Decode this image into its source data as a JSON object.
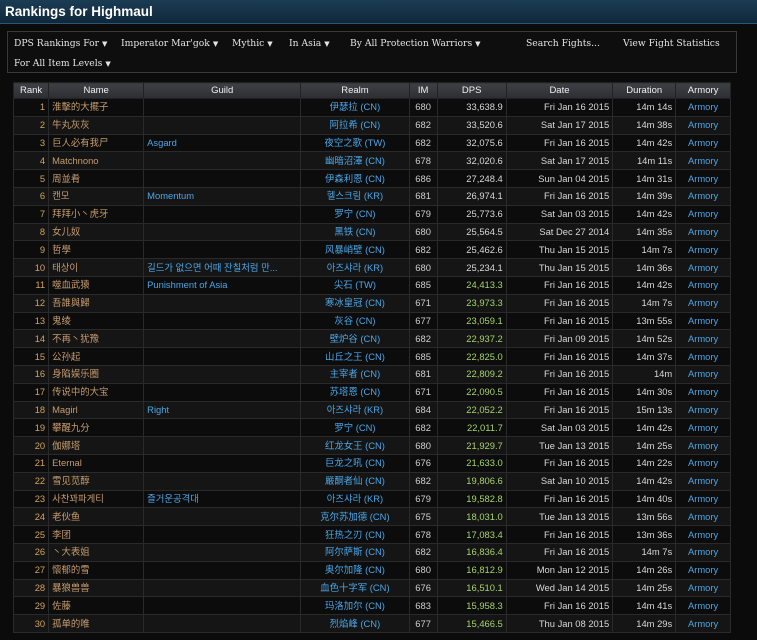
{
  "page": {
    "title": "Rankings for Highmaul"
  },
  "filters": {
    "row1": [
      {
        "label": "DPS Rankings For",
        "dropdown": true
      },
      {
        "label": "Imperator Mar'gok",
        "dropdown": true
      },
      {
        "label": "Mythic",
        "dropdown": true
      },
      {
        "label": "In Asia",
        "dropdown": true
      },
      {
        "label": "By All Protection Warriors",
        "dropdown": true
      },
      {
        "label": "Search Fights...",
        "dropdown": false
      },
      {
        "label": "View Fight Statistics",
        "dropdown": false
      }
    ],
    "row2": [
      {
        "label": "For All Item Levels",
        "dropdown": true
      }
    ]
  },
  "table": {
    "headers": [
      "Rank",
      "Name",
      "Guild",
      "Realm",
      "IM",
      "DPS",
      "Date",
      "Duration",
      "Armory"
    ],
    "rows": [
      [
        "1",
        "淮擊的大擺子",
        "",
        "伊瑟拉 (CN)",
        "680",
        "33,638.9",
        "Fri Jan 16 2015",
        "14m 14s",
        "Armory"
      ],
      [
        "2",
        "牛丸灰灰",
        "",
        "阿拉希 (CN)",
        "682",
        "33,520.6",
        "Sat Jan 17 2015",
        "14m 38s",
        "Armory"
      ],
      [
        "3",
        "巨人必有我尸",
        "Asgard",
        "夜空之歌 (TW)",
        "682",
        "32,075.6",
        "Fri Jan 16 2015",
        "14m 42s",
        "Armory"
      ],
      [
        "4",
        "Matchnono",
        "",
        "幽暗沼澤 (CN)",
        "678",
        "32,020.6",
        "Sat Jan 17 2015",
        "14m 11s",
        "Armory"
      ],
      [
        "5",
        "周並肴",
        "",
        "伊森利恩 (CN)",
        "686",
        "27,248.4",
        "Sun Jan 04 2015",
        "14m 31s",
        "Armory"
      ],
      [
        "6",
        "캔모",
        "Momentum",
        "헬스크림 (KR)",
        "681",
        "26,974.1",
        "Fri Jan 16 2015",
        "14m 39s",
        "Armory"
      ],
      [
        "7",
        "拜拜小丶虎牙",
        "",
        "罗宁 (CN)",
        "679",
        "25,773.6",
        "Sat Jan 03 2015",
        "14m 42s",
        "Armory"
      ],
      [
        "8",
        "女儿奴",
        "",
        "黑铁 (CN)",
        "680",
        "25,564.5",
        "Sat Dec 27 2014",
        "14m 35s",
        "Armory"
      ],
      [
        "9",
        "哲學",
        "",
        "风暴峭壁 (CN)",
        "682",
        "25,462.6",
        "Thu Jan 15 2015",
        "14m 7s",
        "Armory"
      ],
      [
        "10",
        "태상이",
        "길드가 없으면 어때 잔칠처럼 만...",
        "아즈샤라 (KR)",
        "680",
        "25,234.1",
        "Thu Jan 15 2015",
        "14m 36s",
        "Armory"
      ],
      [
        "11",
        "噬血武猿",
        "Punishment of Asia",
        "尖石 (TW)",
        "685",
        "24,413.3",
        "Fri Jan 16 2015",
        "14m 42s",
        "Armory"
      ],
      [
        "12",
        "吾誰與歸",
        "",
        "寒冰皇冠 (CN)",
        "671",
        "23,973.3",
        "Fri Jan 16 2015",
        "14m 7s",
        "Armory"
      ],
      [
        "13",
        "鬼绫",
        "",
        "灰谷 (CN)",
        "677",
        "23,059.1",
        "Fri Jan 16 2015",
        "13m 55s",
        "Armory"
      ],
      [
        "14",
        "不再丶犹豫",
        "",
        "壁炉谷 (CN)",
        "682",
        "22,937.2",
        "Fri Jan 09 2015",
        "14m 52s",
        "Armory"
      ],
      [
        "15",
        "公孙起",
        "",
        "山丘之王 (CN)",
        "685",
        "22,825.0",
        "Fri Jan 16 2015",
        "14m 37s",
        "Armory"
      ],
      [
        "16",
        "身陷娱乐圈",
        "",
        "主宰者 (CN)",
        "681",
        "22,809.2",
        "Fri Jan 16 2015",
        "14m",
        "Armory"
      ],
      [
        "17",
        "传说中的大宝",
        "",
        "苏塔恩 (CN)",
        "671",
        "22,090.5",
        "Fri Jan 16 2015",
        "14m 30s",
        "Armory"
      ],
      [
        "18",
        "Magirl",
        "Right",
        "아즈샤라 (KR)",
        "684",
        "22,052.2",
        "Fri Jan 16 2015",
        "15m 13s",
        "Armory"
      ],
      [
        "19",
        "攀醒九分",
        "",
        "罗宁 (CN)",
        "682",
        "22,011.7",
        "Sat Jan 03 2015",
        "14m 42s",
        "Armory"
      ],
      [
        "20",
        "伽娜塔",
        "",
        "红龙女王 (CN)",
        "680",
        "21,929.7",
        "Tue Jan 13 2015",
        "14m 25s",
        "Armory"
      ],
      [
        "21",
        "Eternal",
        "",
        "巨龙之吼 (CN)",
        "676",
        "21,633.0",
        "Fri Jan 16 2015",
        "14m 22s",
        "Armory"
      ],
      [
        "22",
        "雪见苋醇",
        "",
        "嚴酮者仙 (CN)",
        "682",
        "19,806.6",
        "Sat Jan 10 2015",
        "14m 42s",
        "Armory"
      ],
      [
        "23",
        "사찬꽈파게티",
        "즐거운공격대",
        "아즈샤라 (KR)",
        "679",
        "19,582.8",
        "Fri Jan 16 2015",
        "14m 40s",
        "Armory"
      ],
      [
        "24",
        "老伙鱼",
        "",
        "克尔苏加德 (CN)",
        "675",
        "18,031.0",
        "Tue Jan 13 2015",
        "13m 56s",
        "Armory"
      ],
      [
        "25",
        "李团",
        "",
        "狂热之刃 (CN)",
        "678",
        "17,083.4",
        "Fri Jan 16 2015",
        "13m 36s",
        "Armory"
      ],
      [
        "26",
        "丶大表姐",
        "",
        "阿尔萨斯 (CN)",
        "682",
        "16,836.4",
        "Fri Jan 16 2015",
        "14m 7s",
        "Armory"
      ],
      [
        "27",
        "懷郁的雪",
        "",
        "奥尔加隆 (CN)",
        "680",
        "16,812.9",
        "Mon Jan 12 2015",
        "14m 26s",
        "Armory"
      ],
      [
        "28",
        "暴狼兽兽",
        "",
        "血色十字军 (CN)",
        "676",
        "16,510.1",
        "Wed Jan 14 2015",
        "14m 25s",
        "Armory"
      ],
      [
        "29",
        "佐藤",
        "",
        "玛洛加尔 (CN)",
        "683",
        "15,958.3",
        "Fri Jan 16 2015",
        "14m 41s",
        "Armory"
      ],
      [
        "30",
        "孤单的唯",
        "",
        "烈焰峰 (CN)",
        "677",
        "15,466.5",
        "Thu Jan 08 2015",
        "14m 29s",
        "Armory"
      ]
    ]
  },
  "colors": {
    "header_bar": "#1b3c55",
    "link_blue": "#4aa6e8",
    "rank_orange": "#d2a35c",
    "warrior_tan": "#c79c6e",
    "dps_green": "#7fc844"
  },
  "dps_highlight_threshold_note": ""
}
